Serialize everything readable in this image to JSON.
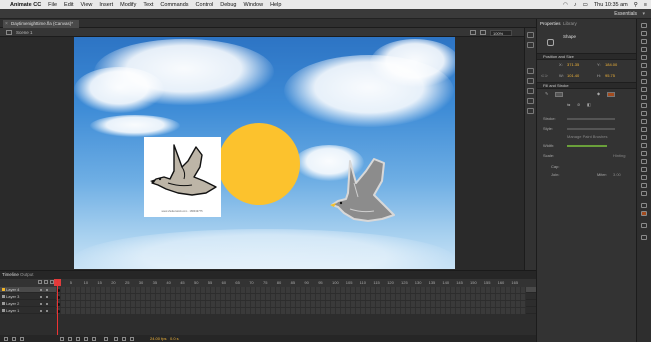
{
  "menubar": {
    "app_name": "Animate CC",
    "items": [
      "File",
      "Edit",
      "View",
      "Insert",
      "Modify",
      "Text",
      "Commands",
      "Control",
      "Debug",
      "Window",
      "Help"
    ],
    "clock": "Thu 10:35 am"
  },
  "appbar": {
    "workspace": "Essentials"
  },
  "document": {
    "tab_title": "Daytimenighttime.fla (Canvas)*",
    "scene": "Scene 1",
    "zoom": "100%"
  },
  "stage": {
    "card_caption": "www.shutterstock.com · 186919775"
  },
  "properties": {
    "tabs": [
      "Properties",
      "Library"
    ],
    "object_type": "Shape",
    "sections": {
      "position_size": "Position and Size",
      "fill_stroke": "Fill and Stroke"
    },
    "x_label": "X:",
    "x_value": "371.35",
    "y_label": "Y:",
    "y_value": "184.00",
    "w_label": "W:",
    "w_value": "101.40",
    "h_label": "H:",
    "h_value": "95.75",
    "stroke_label": "Stroke:",
    "style_label": "Style:",
    "manage_brushes": "Manage Paint Brushes",
    "width_label": "Width:",
    "scale_label": "Scale:",
    "scale_value": "Hinting",
    "cap_label": "Cap:",
    "join_label": "Join:",
    "miter_label": "Miter:",
    "miter_value": "3.00",
    "fill_color": "#a24a1d"
  },
  "timeline": {
    "tabs": [
      "Timeline",
      "Output"
    ],
    "frame_numbers": [
      "1",
      "5",
      "10",
      "15",
      "20",
      "25",
      "30",
      "35",
      "40",
      "45",
      "50",
      "55",
      "60",
      "65",
      "70",
      "75",
      "80",
      "85",
      "90",
      "95",
      "100",
      "105",
      "110",
      "115",
      "120",
      "125",
      "130",
      "135",
      "140",
      "145",
      "150",
      "155",
      "160",
      "165"
    ],
    "layers": [
      "Layer 4",
      "Layer 3",
      "Layer 2",
      "Layer 1"
    ],
    "fps": "24.00 fps",
    "time": "0.0 s"
  }
}
